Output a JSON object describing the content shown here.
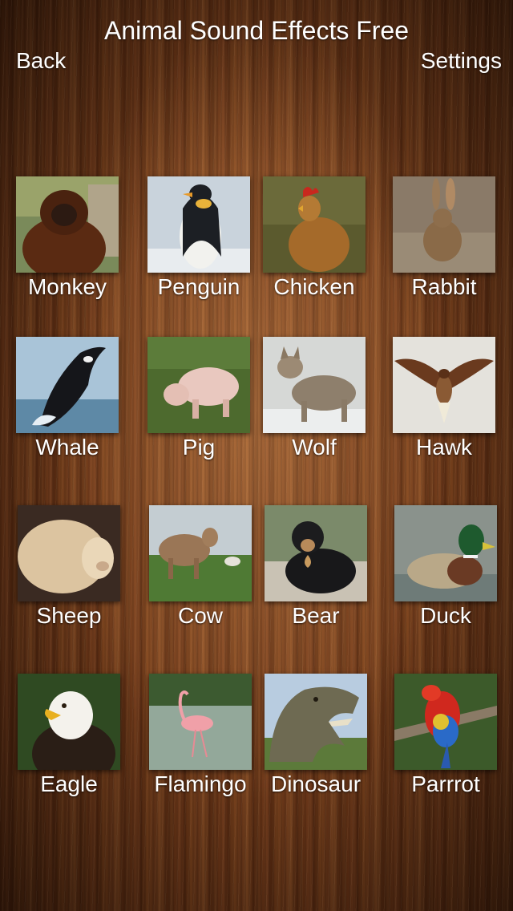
{
  "header": {
    "title": "Animal Sound Effects Free",
    "back_label": "Back",
    "settings_label": "Settings"
  },
  "animals": [
    {
      "label": "Monkey"
    },
    {
      "label": "Penguin"
    },
    {
      "label": "Chicken"
    },
    {
      "label": "Rabbit"
    },
    {
      "label": "Whale"
    },
    {
      "label": "Pig"
    },
    {
      "label": "Wolf"
    },
    {
      "label": "Hawk"
    },
    {
      "label": "Sheep"
    },
    {
      "label": "Cow"
    },
    {
      "label": "Bear"
    },
    {
      "label": "Duck"
    },
    {
      "label": "Eagle"
    },
    {
      "label": "Flamingo"
    },
    {
      "label": "Dinosaur"
    },
    {
      "label": "Parrrot"
    }
  ]
}
